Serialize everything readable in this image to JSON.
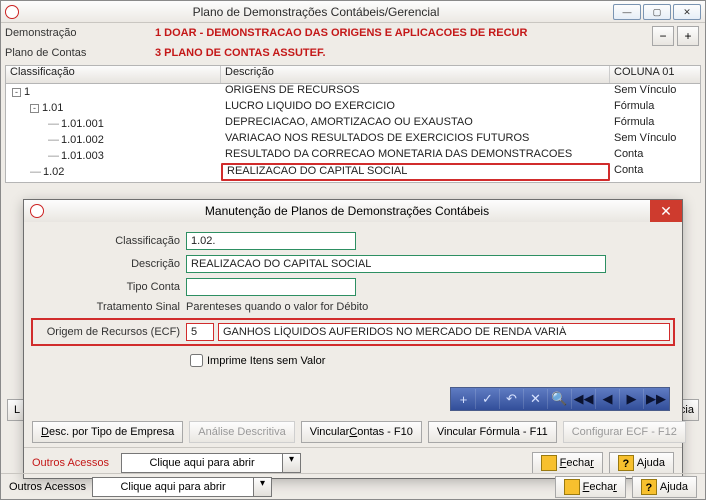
{
  "main": {
    "title": "Plano de Demonstrações Contábeis/Gerencial",
    "labels": {
      "demonstracao": "Demonstração",
      "planocontas": "Plano de Contas"
    },
    "values": {
      "demonstracao": "1 DOAR - DEMONSTRACAO DAS ORIGENS E APLICACOES DE RECUR",
      "planocontas": "3 PLANO DE CONTAS ASSUTEF."
    },
    "minibtn_minus": "−",
    "minibtn_plus": "+",
    "winbtn_min": "—",
    "winbtn_max": "▢",
    "winbtn_close": "✕",
    "sideL": "L",
    "sideA": "icia"
  },
  "grid": {
    "headers": {
      "class": "Classificação",
      "desc": "Descrição",
      "c01": "COLUNA 01"
    },
    "rows": [
      {
        "level": 1,
        "exp": "-",
        "class": "1",
        "desc": "ORIGENS DE RECURSOS",
        "c01": "Sem Vínculo"
      },
      {
        "level": 2,
        "exp": "-",
        "class": "1.01",
        "desc": "LUCRO LIQUIDO DO EXERCICIO",
        "c01": "Fórmula"
      },
      {
        "level": 3,
        "exp": "",
        "class": "1.01.001",
        "desc": "DEPRECIACAO, AMORTIZACAO OU EXAUSTAO",
        "c01": "Fórmula"
      },
      {
        "level": 3,
        "exp": "",
        "class": "1.01.002",
        "desc": "VARIACAO NOS RESULTADOS DE EXERCICIOS FUTUROS",
        "c01": "Sem Vínculo"
      },
      {
        "level": 3,
        "exp": "",
        "class": "1.01.003",
        "desc": "RESULTADO DA CORRECAO MONETARIA DAS DEMONSTRACOES",
        "c01": "Conta"
      },
      {
        "level": 2,
        "exp": "",
        "class": "1.02",
        "desc": "REALIZACAO DO CAPITAL SOCIAL",
        "c01": "Conta",
        "hl": true
      }
    ]
  },
  "sub": {
    "title": "Manutenção de Planos de Demonstrações Contábeis",
    "close": "✕",
    "fields": {
      "class_lbl": "Classificação",
      "class_val": "1.02.",
      "desc_lbl": "Descrição",
      "desc_val": "REALIZACAO DO CAPITAL SOCIAL",
      "tipo_lbl": "Tipo Conta",
      "tipo_val": "",
      "sinal_lbl": "Tratamento Sinal",
      "sinal_val": "Parenteses quando o valor for Débito",
      "origem_lbl": "Origem de Recursos (ECF)",
      "origem_code": "5",
      "origem_desc": "GANHOS LÍQUIDOS AUFERIDOS NO MERCADO DE RENDA VARIÁ",
      "check_lbl": "Imprime Itens sem Valor"
    },
    "toolbar_icons": [
      "+",
      "✓",
      "↶",
      "✕",
      "🔍",
      "◀◀",
      "◀",
      "▶",
      "▶▶"
    ],
    "buttons": {
      "descportipo": "Desc. por Tipo de Empresa",
      "analise": "Análise Descritiva",
      "vinccontas": "Vincular Contas - F10",
      "vincform": "Vincular Fórmula - F11",
      "confecf": "Configurar ECF - F12"
    },
    "footer": {
      "label": "Outros Acessos",
      "combo": "Clique aqui para abrir",
      "fechar": "Fechar",
      "ajuda": "Ajuda"
    }
  },
  "mainfooter": {
    "label": "Outros Acessos",
    "combo": "Clique aqui para abrir",
    "fechar": "Fechar",
    "ajuda": "Ajuda"
  }
}
